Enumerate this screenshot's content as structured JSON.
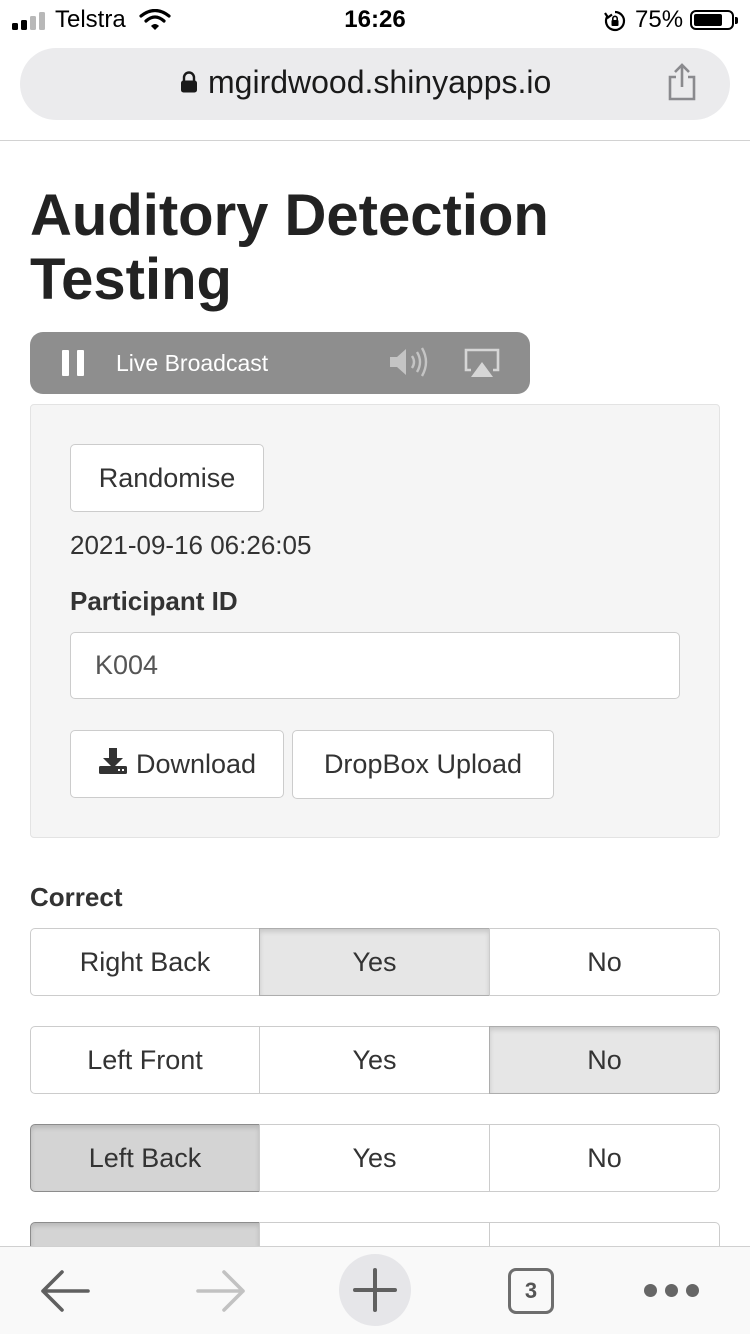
{
  "status_bar": {
    "carrier": "Telstra",
    "time": "16:26",
    "battery_percent": "75%",
    "battery_level": 0.75,
    "signal_bars": 2,
    "icons": [
      "signal-icon",
      "wifi-icon",
      "orientation-lock-icon",
      "battery-icon"
    ]
  },
  "browser": {
    "url": "mgirdwood.shinyapps.io",
    "icons": [
      "padlock-icon",
      "share-icon"
    ],
    "toolbar": {
      "open_tabs": "3",
      "icons": [
        "back-arrow-icon",
        "forward-arrow-icon",
        "plus-icon",
        "tabs-icon",
        "more-dots-icon"
      ]
    }
  },
  "page": {
    "title": "Auditory Detection Testing",
    "media_bar": {
      "label": "Live Broadcast",
      "icons": [
        "pause-icon",
        "speaker-icon",
        "airplay-icon"
      ]
    },
    "controls": {
      "randomise_label": "Randomise",
      "timestamp": "2021-09-16 06:26:05",
      "participant_label": "Participant ID",
      "participant_value": "K004",
      "download_label": "Download",
      "download_icon": "download-icon",
      "dropbox_label": "DropBox Upload"
    },
    "correct": {
      "label": "Correct",
      "rows": [
        {
          "options": [
            "Right Back",
            "Yes",
            "No"
          ],
          "selected": 1
        },
        {
          "options": [
            "Left Front",
            "Yes",
            "No"
          ],
          "selected": 2
        },
        {
          "options": [
            "Left Back",
            "Yes",
            "No"
          ],
          "selected": 0
        }
      ]
    }
  }
}
